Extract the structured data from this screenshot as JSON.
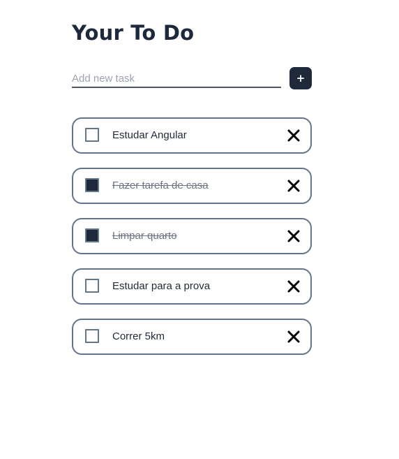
{
  "header": {
    "title": "Your To Do"
  },
  "new_task": {
    "placeholder": "Add new task",
    "value": "",
    "add_label": "+"
  },
  "tasks": [
    {
      "label": "Estudar Angular",
      "done": false
    },
    {
      "label": "Fazer tarefa de casa",
      "done": true
    },
    {
      "label": "Limpar quarto",
      "done": true
    },
    {
      "label": "Estudar para a prova",
      "done": false
    },
    {
      "label": "Correr 5km",
      "done": false
    }
  ],
  "icons": {
    "delete": "close-icon",
    "checkbox_checked": "checkbox-checked",
    "checkbox_unchecked": "checkbox-unchecked"
  },
  "colors": {
    "primary": "#1e293b",
    "border": "#64748b",
    "placeholder": "#9ca3af",
    "done_text": "#6b7280"
  }
}
